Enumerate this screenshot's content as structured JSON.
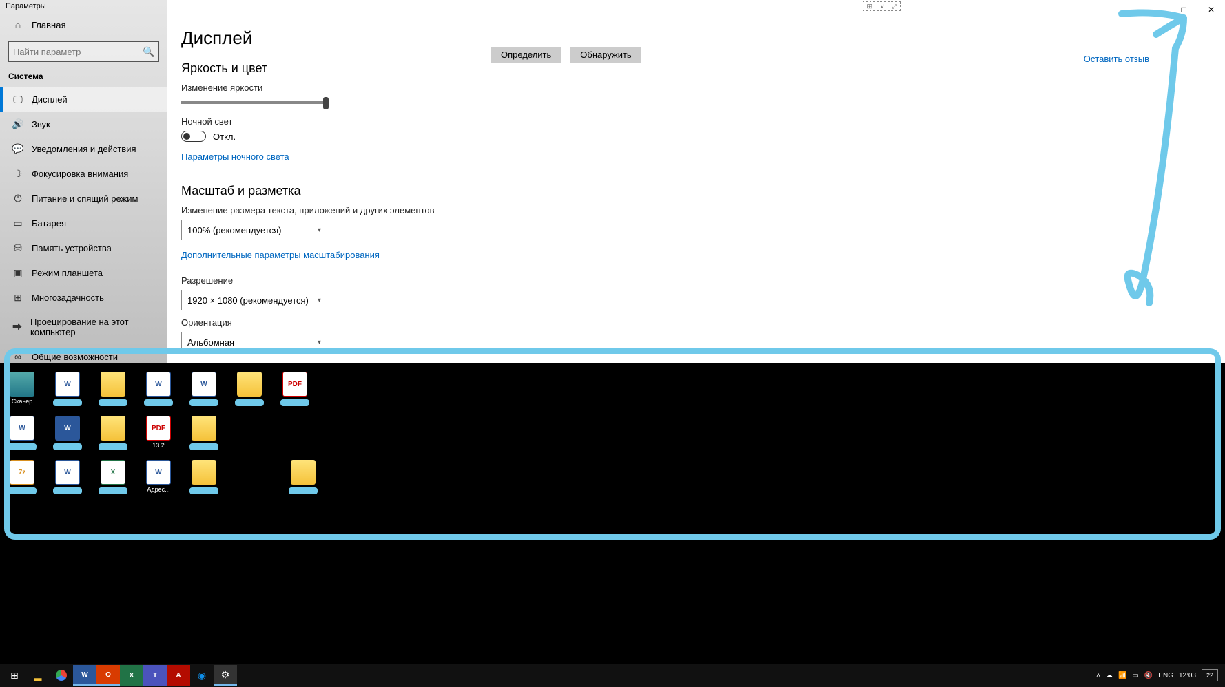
{
  "window": {
    "title": "Параметры",
    "minimize": "—",
    "maximize": "□",
    "close": "✕"
  },
  "sidebar": {
    "home": "Главная",
    "search_placeholder": "Найти параметр",
    "section": "Система",
    "items": [
      {
        "label": "Дисплей"
      },
      {
        "label": "Звук"
      },
      {
        "label": "Уведомления и действия"
      },
      {
        "label": "Фокусировка внимания"
      },
      {
        "label": "Питание и спящий режим"
      },
      {
        "label": "Батарея"
      },
      {
        "label": "Память устройства"
      },
      {
        "label": "Режим планшета"
      },
      {
        "label": "Многозадачность"
      },
      {
        "label": "Проецирование на этот компьютер"
      },
      {
        "label": "Общие возможности"
      }
    ]
  },
  "content": {
    "title": "Дисплей",
    "btn_identify": "Определить",
    "btn_detect": "Обнаружить",
    "feedback": "Оставить отзыв",
    "brightness": {
      "heading": "Яркость и цвет",
      "label": "Изменение яркости",
      "nightlight_label": "Ночной свет",
      "nightlight_state": "Откл.",
      "nightlight_link": "Параметры ночного света"
    },
    "scale": {
      "heading": "Масштаб и разметка",
      "size_label": "Изменение размера текста, приложений и других элементов",
      "size_value": "100% (рекомендуется)",
      "advanced_link": "Дополнительные параметры масштабирования",
      "resolution_label": "Разрешение",
      "resolution_value": "1920 × 1080 (рекомендуется)",
      "orientation_label": "Ориентация",
      "orientation_value": "Альбомная"
    }
  },
  "desktop": {
    "row1": [
      {
        "type": "scanner",
        "label": "Сканер"
      },
      {
        "type": "word",
        "label": ""
      },
      {
        "type": "folder",
        "label": ""
      },
      {
        "type": "word",
        "label": ""
      },
      {
        "type": "word",
        "label": ""
      },
      {
        "type": "folder",
        "label": ""
      },
      {
        "type": "pdf",
        "label": ""
      }
    ],
    "row2": [
      {
        "type": "word",
        "label": ""
      },
      {
        "type": "word2",
        "label": ""
      },
      {
        "type": "folder",
        "label": ""
      },
      {
        "type": "pdf",
        "label": "13.2"
      },
      {
        "type": "folder",
        "label": ""
      }
    ],
    "row3": [
      {
        "type": "zip",
        "label": ""
      },
      {
        "type": "word",
        "label": ""
      },
      {
        "type": "excel",
        "label": ""
      },
      {
        "type": "word",
        "label": "Адрес..."
      },
      {
        "type": "folder",
        "label": ""
      },
      {
        "type": "folder",
        "label": ""
      }
    ]
  },
  "taskbar": {
    "lang": "ENG",
    "time": "12:03",
    "notif": "22"
  }
}
